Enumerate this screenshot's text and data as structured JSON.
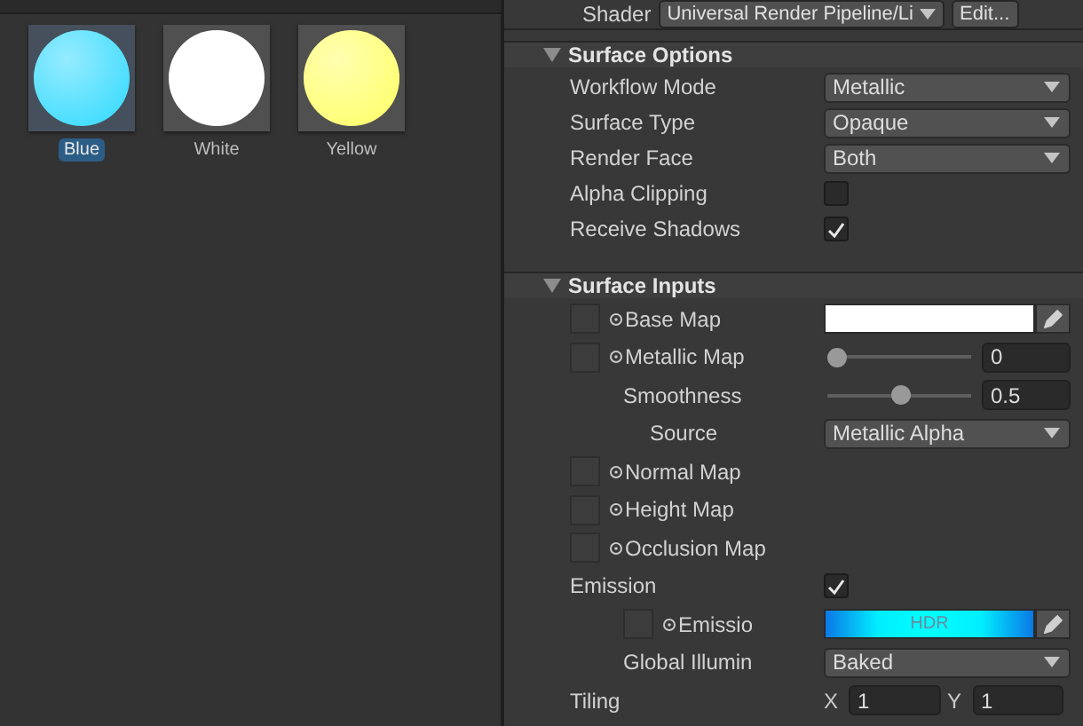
{
  "materials": [
    {
      "name": "Blue",
      "selected": true,
      "color": "#3fdcff"
    },
    {
      "name": "White",
      "selected": false,
      "color": "#ffffff"
    },
    {
      "name": "Yellow",
      "selected": false,
      "color": "#ffff70"
    }
  ],
  "inspector": {
    "shader": {
      "label": "Shader",
      "value": "Universal Render Pipeline/Li",
      "button": "Edit..."
    },
    "sections": [
      {
        "title": "Surface Options",
        "expanded": true,
        "rows": [
          {
            "kind": "dropdown",
            "label": "Workflow Mode",
            "value": "Metallic"
          },
          {
            "kind": "dropdown",
            "label": "Surface Type",
            "value": "Opaque"
          },
          {
            "kind": "dropdown",
            "label": "Render Face",
            "value": "Both"
          },
          {
            "kind": "checkbox",
            "label": "Alpha Clipping",
            "checked": false
          },
          {
            "kind": "checkbox",
            "label": "Receive Shadows",
            "checked": true
          }
        ]
      },
      {
        "title": "Surface Inputs",
        "expanded": true,
        "rows": [
          {
            "kind": "texture-color",
            "label": "Base Map",
            "color": "#ffffff"
          },
          {
            "kind": "texture-slider",
            "label": "Metallic Map",
            "level": 0,
            "value": "0",
            "children": [
              {
                "kind": "slider",
                "label": "Smoothness",
                "level": 0.5,
                "value": "0.5",
                "children": [
                  {
                    "kind": "dropdown",
                    "label": "Source",
                    "value": "Metallic Alpha"
                  }
                ]
              }
            ]
          },
          {
            "kind": "texture",
            "label": "Normal Map"
          },
          {
            "kind": "texture",
            "label": "Height Map"
          },
          {
            "kind": "texture",
            "label": "Occlusion Map"
          },
          {
            "kind": "checkbox",
            "label": "Emission",
            "checked": true,
            "children": [
              {
                "kind": "texture-hdr",
                "label": "Emissio",
                "value": "HDR"
              },
              {
                "kind": "dropdown",
                "label": "Global Illumin",
                "value": "Baked"
              }
            ]
          },
          {
            "kind": "vector",
            "label": "Tiling",
            "fields": [
              {
                "axis": "X",
                "value": "1"
              },
              {
                "axis": "Y",
                "value": "1"
              }
            ]
          }
        ]
      }
    ]
  }
}
